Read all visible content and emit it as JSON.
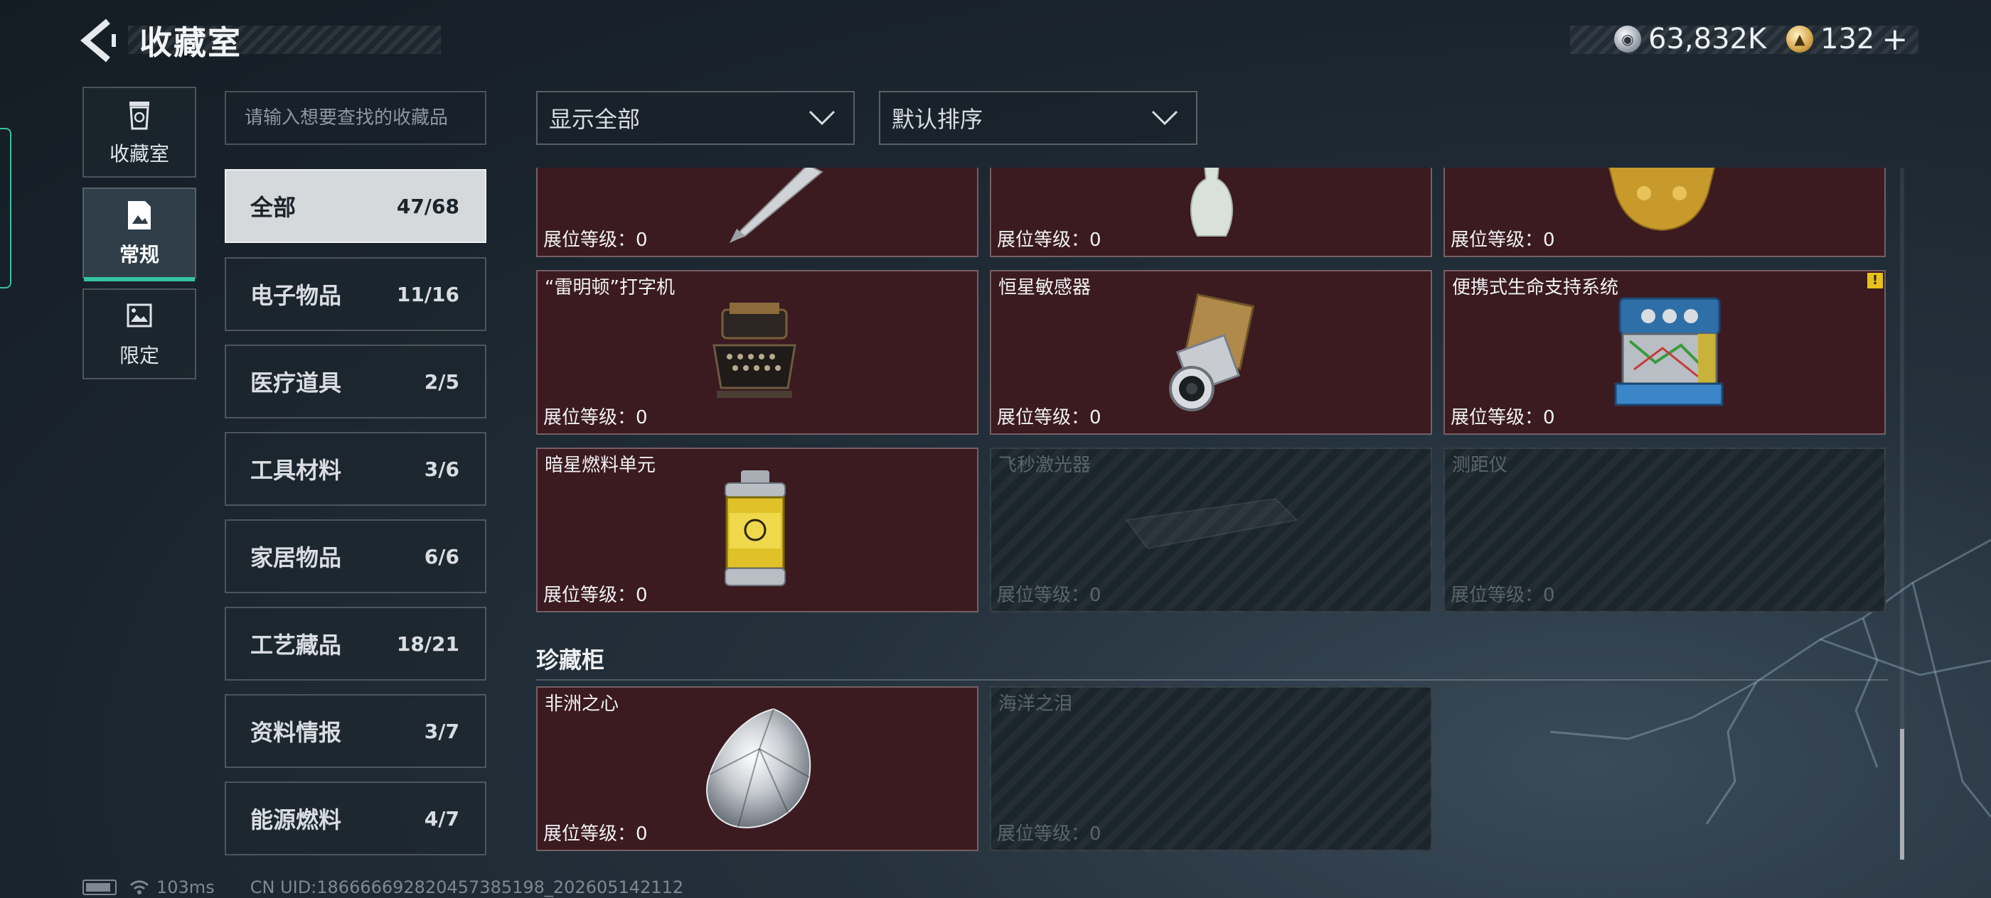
{
  "header": {
    "title": "收藏室",
    "currency_silver": "63,832K",
    "currency_gold": "132"
  },
  "side_nav": [
    {
      "label": "收藏室",
      "icon": "trash-bin-icon"
    },
    {
      "label": "常规",
      "icon": "image-doc-icon"
    },
    {
      "label": "限定",
      "icon": "picture-icon"
    }
  ],
  "search": {
    "placeholder": "请输入想要查找的收藏品",
    "value": ""
  },
  "categories": [
    {
      "name": "全部",
      "count": "47/68"
    },
    {
      "name": "电子物品",
      "count": "11/16"
    },
    {
      "name": "医疗道具",
      "count": "2/5"
    },
    {
      "name": "工具材料",
      "count": "3/6"
    },
    {
      "name": "家居物品",
      "count": "6/6"
    },
    {
      "name": "工艺藏品",
      "count": "18/21"
    },
    {
      "name": "资料情报",
      "count": "3/7"
    },
    {
      "name": "能源燃料",
      "count": "4/7"
    }
  ],
  "filters": {
    "show": "显示全部",
    "sort": "默认排序"
  },
  "level_label": "展位等级：0",
  "items": [
    {
      "name": "",
      "owned": true,
      "icon": "fountain-pen-icon"
    },
    {
      "name": "",
      "owned": true,
      "icon": "ceramic-vase-icon"
    },
    {
      "name": "",
      "owned": true,
      "icon": "golden-statue-icon"
    },
    {
      "name": "“雷明顿”打字机",
      "owned": true,
      "icon": "typewriter-icon"
    },
    {
      "name": "恒星敏感器",
      "owned": true,
      "icon": "star-sensor-icon"
    },
    {
      "name": "便携式生命支持系统",
      "owned": true,
      "icon": "life-support-icon",
      "warning": "!"
    },
    {
      "name": "暗星燃料单元",
      "owned": true,
      "icon": "fuel-canister-icon"
    },
    {
      "name": "飞秒激光器",
      "owned": false,
      "icon": "laser-icon"
    },
    {
      "name": "测距仪",
      "owned": false,
      "icon": "rangefinder-icon"
    }
  ],
  "section": {
    "title": "珍藏柜"
  },
  "treasures": [
    {
      "name": "非洲之心",
      "owned": true,
      "icon": "diamond-icon"
    },
    {
      "name": "海洋之泪",
      "owned": false,
      "icon": "gem-icon"
    }
  ],
  "status": {
    "ping": "103ms",
    "uid": "CN UID:18666669282045738519​8_202605142112"
  }
}
